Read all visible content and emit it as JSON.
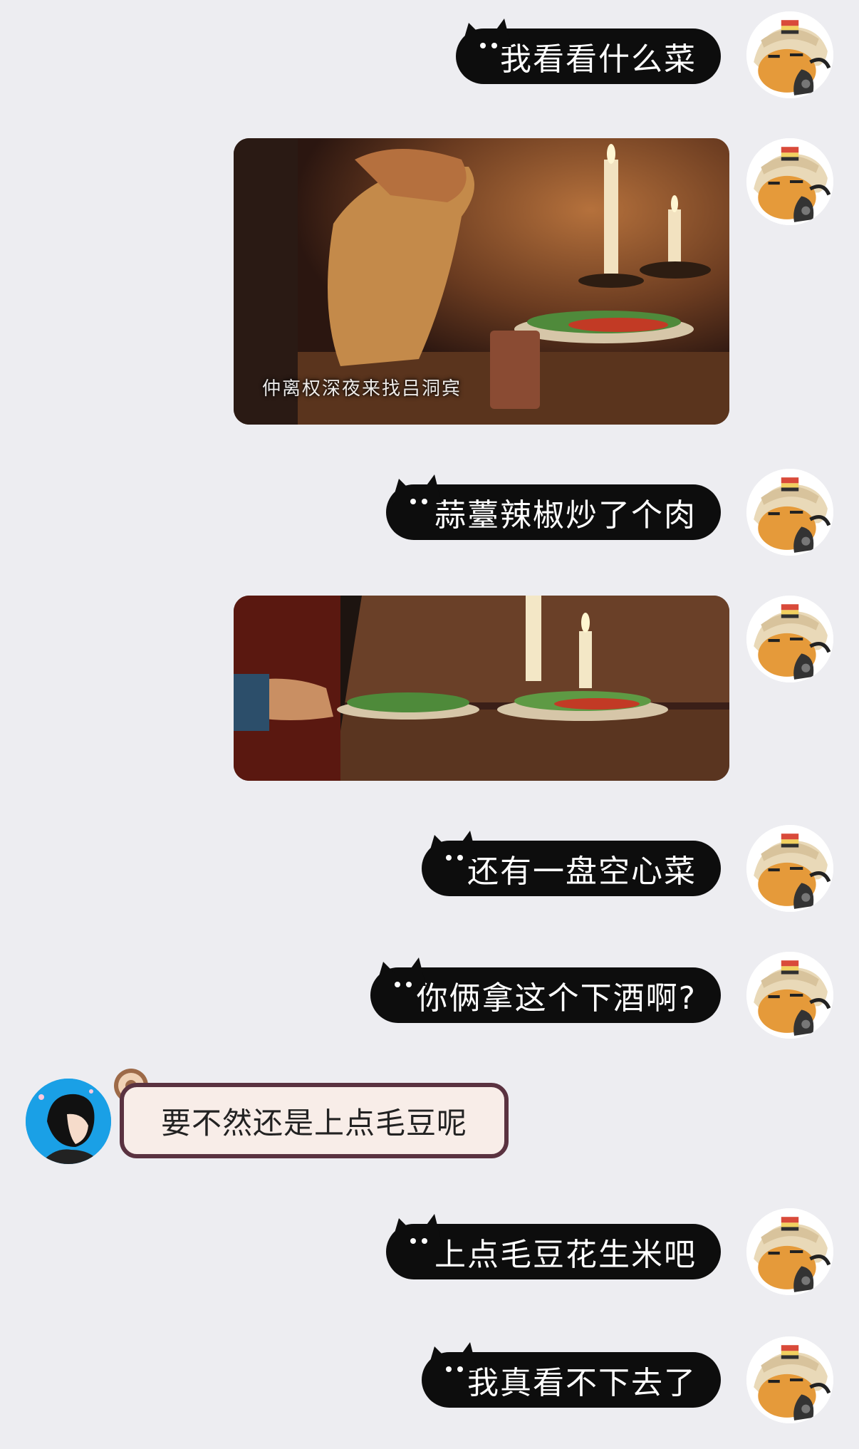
{
  "messages": [
    {
      "side": "right",
      "type": "text",
      "text": "我看看什么菜"
    },
    {
      "side": "right",
      "type": "image",
      "caption": "仲离权深夜来找吕洞宾",
      "alt": "pouring-wine-scene"
    },
    {
      "side": "right",
      "type": "text",
      "text": "蒜薹辣椒炒了个肉"
    },
    {
      "side": "right",
      "type": "image",
      "caption": "",
      "alt": "dishes-on-table-scene"
    },
    {
      "side": "right",
      "type": "text",
      "text": "还有一盘空心菜"
    },
    {
      "side": "right",
      "type": "text",
      "text": "你俩拿这个下酒啊?"
    },
    {
      "side": "left",
      "type": "text",
      "text": "要不然还是上点毛豆呢"
    },
    {
      "side": "right",
      "type": "text",
      "text": "上点毛豆花生米吧"
    },
    {
      "side": "right",
      "type": "text",
      "text": "我真看不下去了"
    }
  ],
  "colors": {
    "background": "#ededf1",
    "bubble_dark": "#0d0d0d",
    "bubble_pink": "#f8ede8",
    "bubble_pink_border": "#5a3240"
  }
}
